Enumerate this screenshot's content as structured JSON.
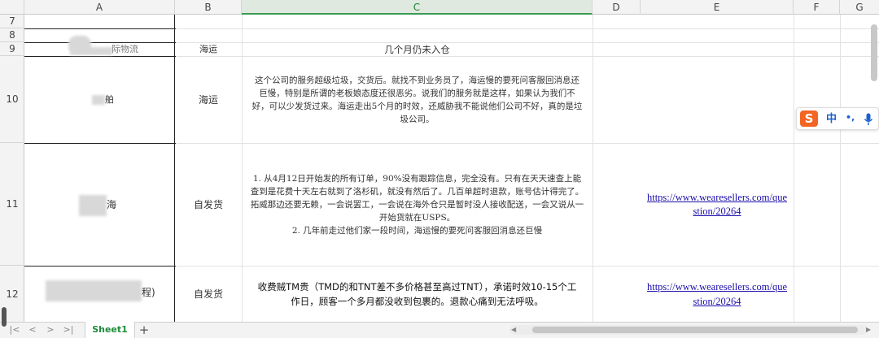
{
  "columns": [
    "A",
    "B",
    "C",
    "D",
    "E",
    "F",
    "G"
  ],
  "rows": {
    "r7": "7",
    "r8": "8",
    "r9": "9",
    "r10": "10",
    "r11": "11",
    "r12": "12"
  },
  "cells": {
    "a9": "际物流",
    "b9": "海运",
    "c9": "几个月仍未入仓",
    "a10": "舶",
    "b10": "海运",
    "c10": "这个公司的服务超级垃圾，交货后。就找不到业务员了，海运慢的要死问客服回消息还巨慢，特别是所谓的老板娘态度还很恶劣。说我们的服务就是这样，如果认为我们不好，可以少发货过来。海运走出5个月的时效，还威胁我不能说他们公司不好，真的是垃圾公司。",
    "a11": "海",
    "b11": "自发货",
    "c11_1": "1.  从4月12日开始发的所有订单，90%没有跟踪信息，完全没有。只有在天天速查上能查到是花费十天左右就到了洛杉矶，就没有然后了。几百单超时退款，账号估计得完了。拓威那边还要无赖，一会说罢工，一会说在海外仓只是暂时没人接收配送，一会又说从一开始货就在USPS。",
    "c11_2": "2.  几年前走过他们家一段时间，海运慢的要死问客服回消息还巨慢",
    "e11": "https://www.wearesellers.com/question/20264",
    "a12": "程)",
    "b12": "自发货",
    "c12": "收费贼TM贵（TMD的和TNT差不多价格甚至高过TNT），承诺时效10-15个工作日，顾客一个多月都没收到包裹的。退款心痛到无法呼吸。",
    "e12": "https://www.wearesellers.com/question/20264"
  },
  "sheet_tab": "Sheet1",
  "add_sheet": "+",
  "nav": [
    "|<",
    "<",
    ">",
    ">|"
  ],
  "ime": {
    "logo": "S",
    "lang": "中",
    "punct": "•,",
    "mic": "mic-icon"
  }
}
